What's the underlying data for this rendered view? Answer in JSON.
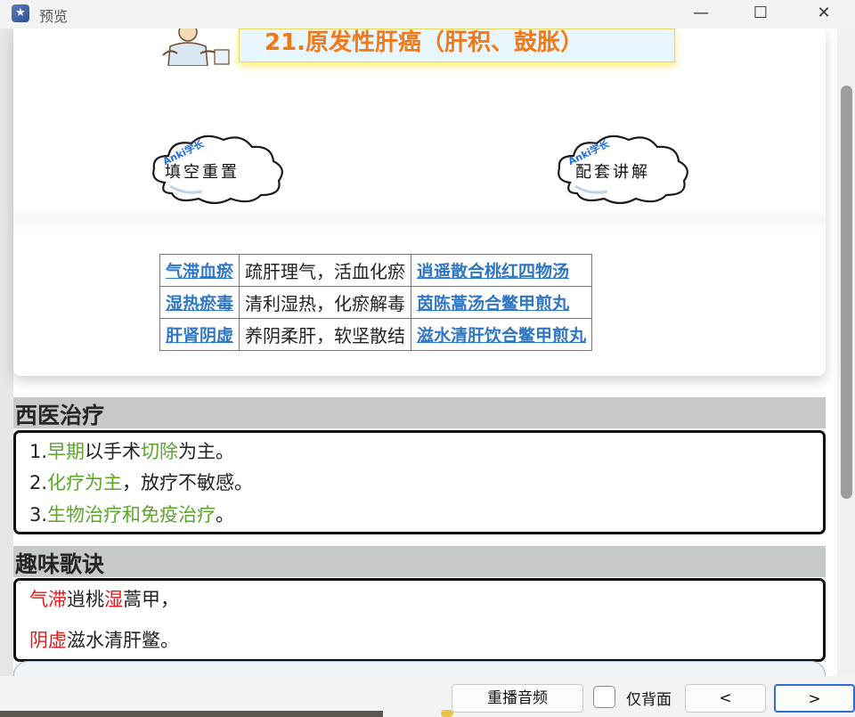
{
  "window": {
    "title": "预览",
    "controls": {
      "minimize": "—",
      "maximize": "☐",
      "close": "✕"
    }
  },
  "banner": {
    "title": "21.原发性肝癌（肝积、鼓胀）"
  },
  "clouds": [
    {
      "tag": "Anki学长",
      "label": "填空重置"
    },
    {
      "tag": "Anki学长",
      "label": "配套讲解"
    }
  ],
  "tcm_table": {
    "rows": [
      {
        "pattern": "气滞血瘀",
        "principle": "疏肝理气，活血化瘀",
        "formula": "逍遥散合桃红四物汤"
      },
      {
        "pattern": "湿热瘀毒",
        "principle": "清利湿热，化瘀解毒",
        "formula": "茵陈蒿汤合鳖甲煎丸"
      },
      {
        "pattern": "肝肾阴虚",
        "principle": "养阴柔肝，软坚散结",
        "formula": "滋水清肝饮合鳖甲煎丸"
      }
    ]
  },
  "western": {
    "title": "西医治疗",
    "items": [
      {
        "n": "1.",
        "a": "早期",
        "b": "以手术",
        "c": "切除",
        "d": "为主。"
      },
      {
        "n": "2.",
        "a": "化疗为主",
        "b": "，放疗不敏感。"
      },
      {
        "n": "3.",
        "a": "生物治疗和免疫治疗",
        "b": "。"
      }
    ]
  },
  "mnemonic": {
    "title": "趣味歌诀",
    "lines": [
      {
        "r1": "气滞",
        "t1": "逍桃",
        "r2": "湿",
        "t2": "蒿甲，"
      },
      {
        "r1": "阴虚",
        "t1": "滋水清肝鳖。"
      }
    ]
  },
  "bottom_bar": {
    "replay": "重播音频",
    "back_only": "仅背面",
    "prev": "<",
    "next": ">"
  },
  "colors": {
    "green": "#5aa52a",
    "red": "#e11818",
    "link": "#2f76c4",
    "banner_text": "#f07a18"
  }
}
